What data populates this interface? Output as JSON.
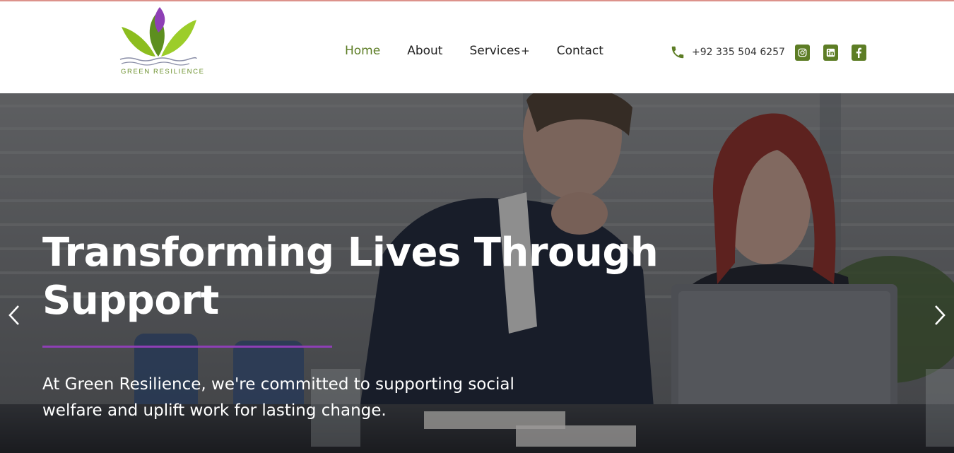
{
  "brand": {
    "name": "GREEN RESILIENCE",
    "colors": {
      "green": "#5d7d25",
      "lime": "#8cbd1f",
      "purple": "#8e3fb5",
      "text": "#222222"
    }
  },
  "nav": {
    "items": [
      {
        "label": "Home",
        "active": true
      },
      {
        "label": "About",
        "active": false
      },
      {
        "label": "Services",
        "active": false
      },
      {
        "label": "Contact",
        "active": false
      }
    ],
    "services_indicator": "+"
  },
  "contact": {
    "phone": "+92 335 504 6257",
    "icons": [
      "phone-icon",
      "instagram-icon",
      "linkedin-icon",
      "facebook-icon"
    ]
  },
  "hero": {
    "title": "Transforming Lives Through Support",
    "subtitle": "At Green Resilience, we're committed to supporting social welfare and uplift work for lasting change.",
    "prev_icon": "chevron-left-icon",
    "next_icon": "chevron-right-icon"
  }
}
